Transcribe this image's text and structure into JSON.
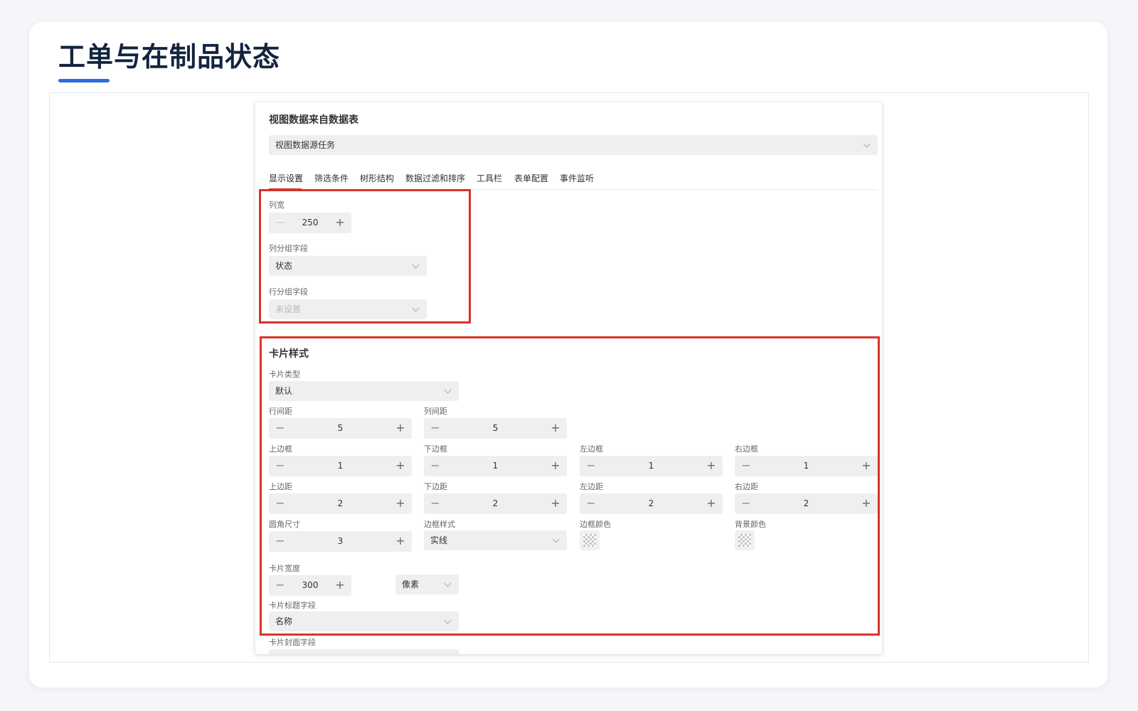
{
  "page": {
    "title": "工单与在制品状态"
  },
  "panel": {
    "data_source_heading": "视图数据来自数据表",
    "data_source_value": "视图数据源任务",
    "tabs": [
      {
        "label": "显示设置",
        "active": true
      },
      {
        "label": "筛选条件",
        "active": false
      },
      {
        "label": "树形结构",
        "active": false
      },
      {
        "label": "数据过滤和排序",
        "active": false
      },
      {
        "label": "工具栏",
        "active": false
      },
      {
        "label": "表单配置",
        "active": false
      },
      {
        "label": "事件监听",
        "active": false
      }
    ],
    "display": {
      "column_width": {
        "label": "列宽",
        "value": "250"
      },
      "column_group": {
        "label": "列分组字段",
        "value": "状态"
      },
      "row_group": {
        "label": "行分组字段",
        "placeholder": "未设置"
      }
    },
    "card_style": {
      "heading": "卡片样式",
      "card_type": {
        "label": "卡片类型",
        "value": "默认"
      },
      "row_spacing": {
        "label": "行间距",
        "value": "5"
      },
      "col_spacing": {
        "label": "列间距",
        "value": "5"
      },
      "border_top": {
        "label": "上边框",
        "value": "1"
      },
      "border_bottom": {
        "label": "下边框",
        "value": "1"
      },
      "border_left": {
        "label": "左边框",
        "value": "1"
      },
      "border_right": {
        "label": "右边框",
        "value": "1"
      },
      "padding_top": {
        "label": "上边距",
        "value": "2"
      },
      "padding_bottom": {
        "label": "下边距",
        "value": "2"
      },
      "padding_left": {
        "label": "左边距",
        "value": "2"
      },
      "padding_right": {
        "label": "右边距",
        "value": "2"
      },
      "radius": {
        "label": "圆角尺寸",
        "value": "3"
      },
      "border_style": {
        "label": "边框样式",
        "value": "实线"
      },
      "border_color": {
        "label": "边框颜色"
      },
      "bg_color": {
        "label": "背景颜色"
      },
      "card_width": {
        "label": "卡片宽度",
        "value": "300",
        "unit": "像素"
      },
      "title_field": {
        "label": "卡片标题字段",
        "value": "名称"
      },
      "cover_field": {
        "label": "卡片封面字段"
      }
    }
  },
  "colors": {
    "accent": "#2d6ce0",
    "highlight": "#d9342b",
    "tab_active": "#c9302c"
  }
}
